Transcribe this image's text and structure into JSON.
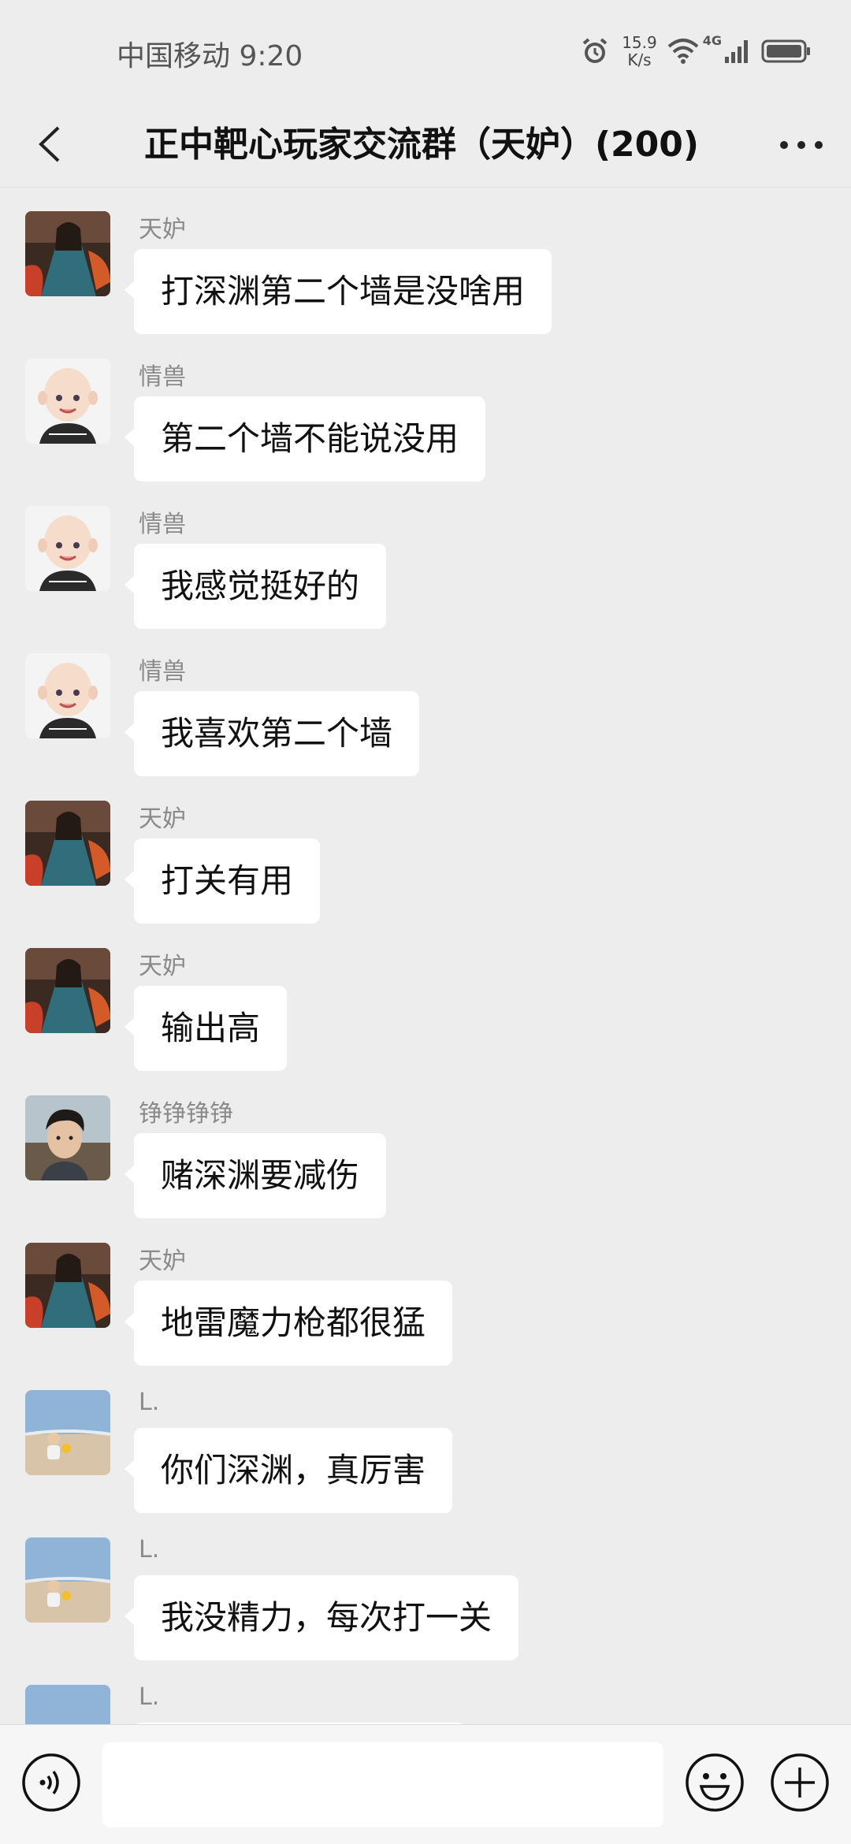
{
  "status_bar": {
    "carrier_time": "中国移动 9:20",
    "net_speed_value": "15.9",
    "net_speed_unit": "K/s",
    "network_type": "4G",
    "icons": [
      "alarm-icon",
      "wifi-icon",
      "signal-icon",
      "battery-icon"
    ]
  },
  "header": {
    "title": "正中靶心玩家交流群（天妒）(200)",
    "back_icon": "chevron-left-icon",
    "more_icon": "more-dots-icon"
  },
  "messages": [
    {
      "sender": "天妒",
      "avatar": "avatar-warrior",
      "text": "打深渊第二个墙是没啥用"
    },
    {
      "sender": "情兽",
      "avatar": "avatar-cartoon-man",
      "text": "第二个墙不能说没用"
    },
    {
      "sender": "情兽",
      "avatar": "avatar-cartoon-man",
      "text": "我感觉挺好的"
    },
    {
      "sender": "情兽",
      "avatar": "avatar-cartoon-man",
      "text": "我喜欢第二个墙"
    },
    {
      "sender": "天妒",
      "avatar": "avatar-warrior",
      "text": "打关有用"
    },
    {
      "sender": "天妒",
      "avatar": "avatar-warrior",
      "text": "输出高"
    },
    {
      "sender": "铮铮铮铮",
      "avatar": "avatar-child-photo",
      "text": "赌深渊要减伤"
    },
    {
      "sender": "天妒",
      "avatar": "avatar-warrior",
      "text": "地雷魔力枪都很猛"
    },
    {
      "sender": "L.",
      "avatar": "avatar-beach-child",
      "text": "你们深渊，真厉害"
    },
    {
      "sender": "L.",
      "avatar": "avatar-beach-child",
      "text": "我没精力，每次打一关"
    },
    {
      "sender": "L.",
      "avatar": "avatar-beach-child",
      "text": ""
    }
  ],
  "input_bar": {
    "voice_icon": "voice-icon",
    "text_value": "",
    "emoji_icon": "emoji-icon",
    "plus_icon": "plus-icon"
  },
  "colors": {
    "background": "#ededed",
    "bubble": "#ffffff",
    "sender_name": "#8a8a8a"
  }
}
